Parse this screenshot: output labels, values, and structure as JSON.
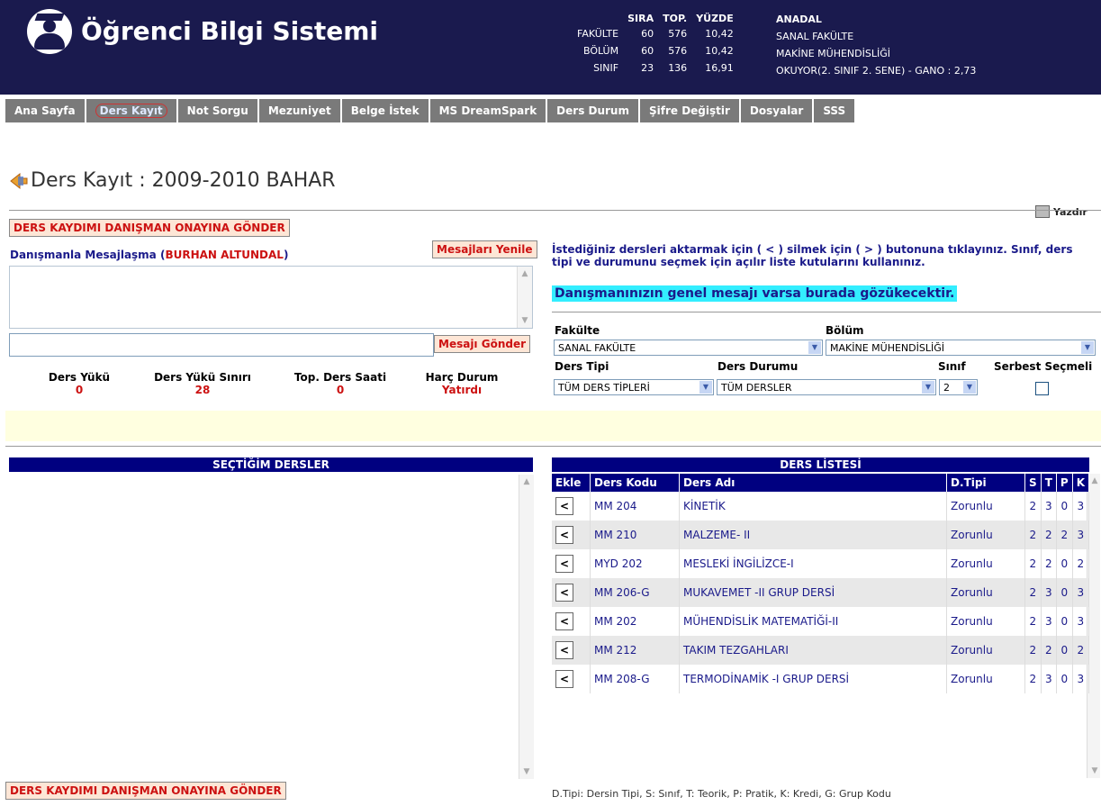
{
  "header": {
    "app_title": "Öğrenci Bilgi Sistemi",
    "stats_headers": [
      "SIRA",
      "TOP.",
      "YÜZDE"
    ],
    "stats_rows": [
      {
        "label": "FAKÜLTE",
        "sira": "60",
        "top": "576",
        "yuzde": "10,42"
      },
      {
        "label": "BÖLÜM",
        "sira": "60",
        "top": "576",
        "yuzde": "10,42"
      },
      {
        "label": "SINIF",
        "sira": "23",
        "top": "136",
        "yuzde": "16,91"
      }
    ],
    "anadal_label": "ANADAL",
    "faculty": "SANAL FAKÜLTE",
    "department": "MAKİNE MÜHENDİSLİĞİ",
    "status": "OKUYOR(2. SINIF 2. SENE) - GANO : 2,73"
  },
  "nav": [
    "Ana Sayfa",
    "Ders Kayıt",
    "Not Sorgu",
    "Mezuniyet",
    "Belge İstek",
    "MS DreamSpark",
    "Ders Durum",
    "Şifre Değiştir",
    "Dosyalar",
    "SSS"
  ],
  "page_title": "Ders Kayıt : 2009-2010 BAHAR",
  "print_label": "Yazdır",
  "send_to_advisor": "DERS KAYDIMI DANIŞMAN ONAYINA GÖNDER",
  "messaging": {
    "label": "Danışmanla Mesajlaşma (",
    "advisor": "BURHAN ALTUNDAL",
    "close": ")",
    "refresh": "Mesajları Yenile",
    "send": "Mesajı Gönder"
  },
  "load": {
    "ders_yuku_label": "Ders Yükü",
    "ders_yuku": "0",
    "ders_yuku_siniri_label": "Ders Yükü Sınırı",
    "ders_yuku_siniri": "28",
    "top_ders_saati_label": "Top. Ders Saati",
    "top_ders_saati": "0",
    "harc_durum_label": "Harç Durum",
    "harc_durum": "Yatırdı"
  },
  "instructions": "İstediğiniz dersleri aktarmak için ( < ) silmek için ( > ) butonuna tıklayınız. Sınıf, ders tipi ve durumunu seçmek için açılır liste kutularını kullanınız.",
  "advisor_message": "Danışmanınızın genel mesajı varsa burada gözükecektir.",
  "filters": {
    "fakulte_label": "Fakülte",
    "fakulte_value": "SANAL FAKÜLTE",
    "bolum_label": "Bölüm",
    "bolum_value": "MAKİNE MÜHENDİSLİĞİ",
    "ders_tipi_label": "Ders Tipi",
    "ders_tipi_value": "TÜM DERS TİPLERİ",
    "ders_durumu_label": "Ders Durumu",
    "ders_durumu_value": "TÜM DERSLER",
    "sinif_label": "Sınıf",
    "sinif_value": "2",
    "serbest_label": "Serbest Seçmeli"
  },
  "selected_title": "SEÇTİĞİM DERSLER",
  "list_title": "DERS LİSTESİ",
  "columns": [
    "Ekle",
    "Ders Kodu",
    "Ders Adı",
    "D.Tipi",
    "S",
    "T",
    "P",
    "K"
  ],
  "courses": [
    {
      "add": "<",
      "code": "MM 204",
      "name": "KİNETİK",
      "type": "Zorunlu",
      "s": "2",
      "t": "3",
      "p": "0",
      "k": "3"
    },
    {
      "add": "<",
      "code": "MM 210",
      "name": "MALZEME- II",
      "type": "Zorunlu",
      "s": "2",
      "t": "2",
      "p": "2",
      "k": "3"
    },
    {
      "add": "<",
      "code": "MYD 202",
      "name": "MESLEKİ İNGİLİZCE-I",
      "type": "Zorunlu",
      "s": "2",
      "t": "2",
      "p": "0",
      "k": "2"
    },
    {
      "add": "<",
      "code": "MM 206-G",
      "name": "MUKAVEMET -II GRUP DERSİ",
      "type": "Zorunlu",
      "s": "2",
      "t": "3",
      "p": "0",
      "k": "3"
    },
    {
      "add": "<",
      "code": "MM 202",
      "name": "MÜHENDİSLİK MATEMATİĞİ-II",
      "type": "Zorunlu",
      "s": "2",
      "t": "3",
      "p": "0",
      "k": "3"
    },
    {
      "add": "<",
      "code": "MM 212",
      "name": "TAKIM TEZGAHLARI",
      "type": "Zorunlu",
      "s": "2",
      "t": "2",
      "p": "0",
      "k": "2"
    },
    {
      "add": "<",
      "code": "MM 208-G",
      "name": "TERMODİNAMİK -I GRUP DERSİ",
      "type": "Zorunlu",
      "s": "2",
      "t": "3",
      "p": "0",
      "k": "3"
    }
  ],
  "legend": "D.Tipi: Dersin Tipi, S: Sınıf, T: Teorik, P: Pratik, K: Kredi, G: Grup Kodu"
}
